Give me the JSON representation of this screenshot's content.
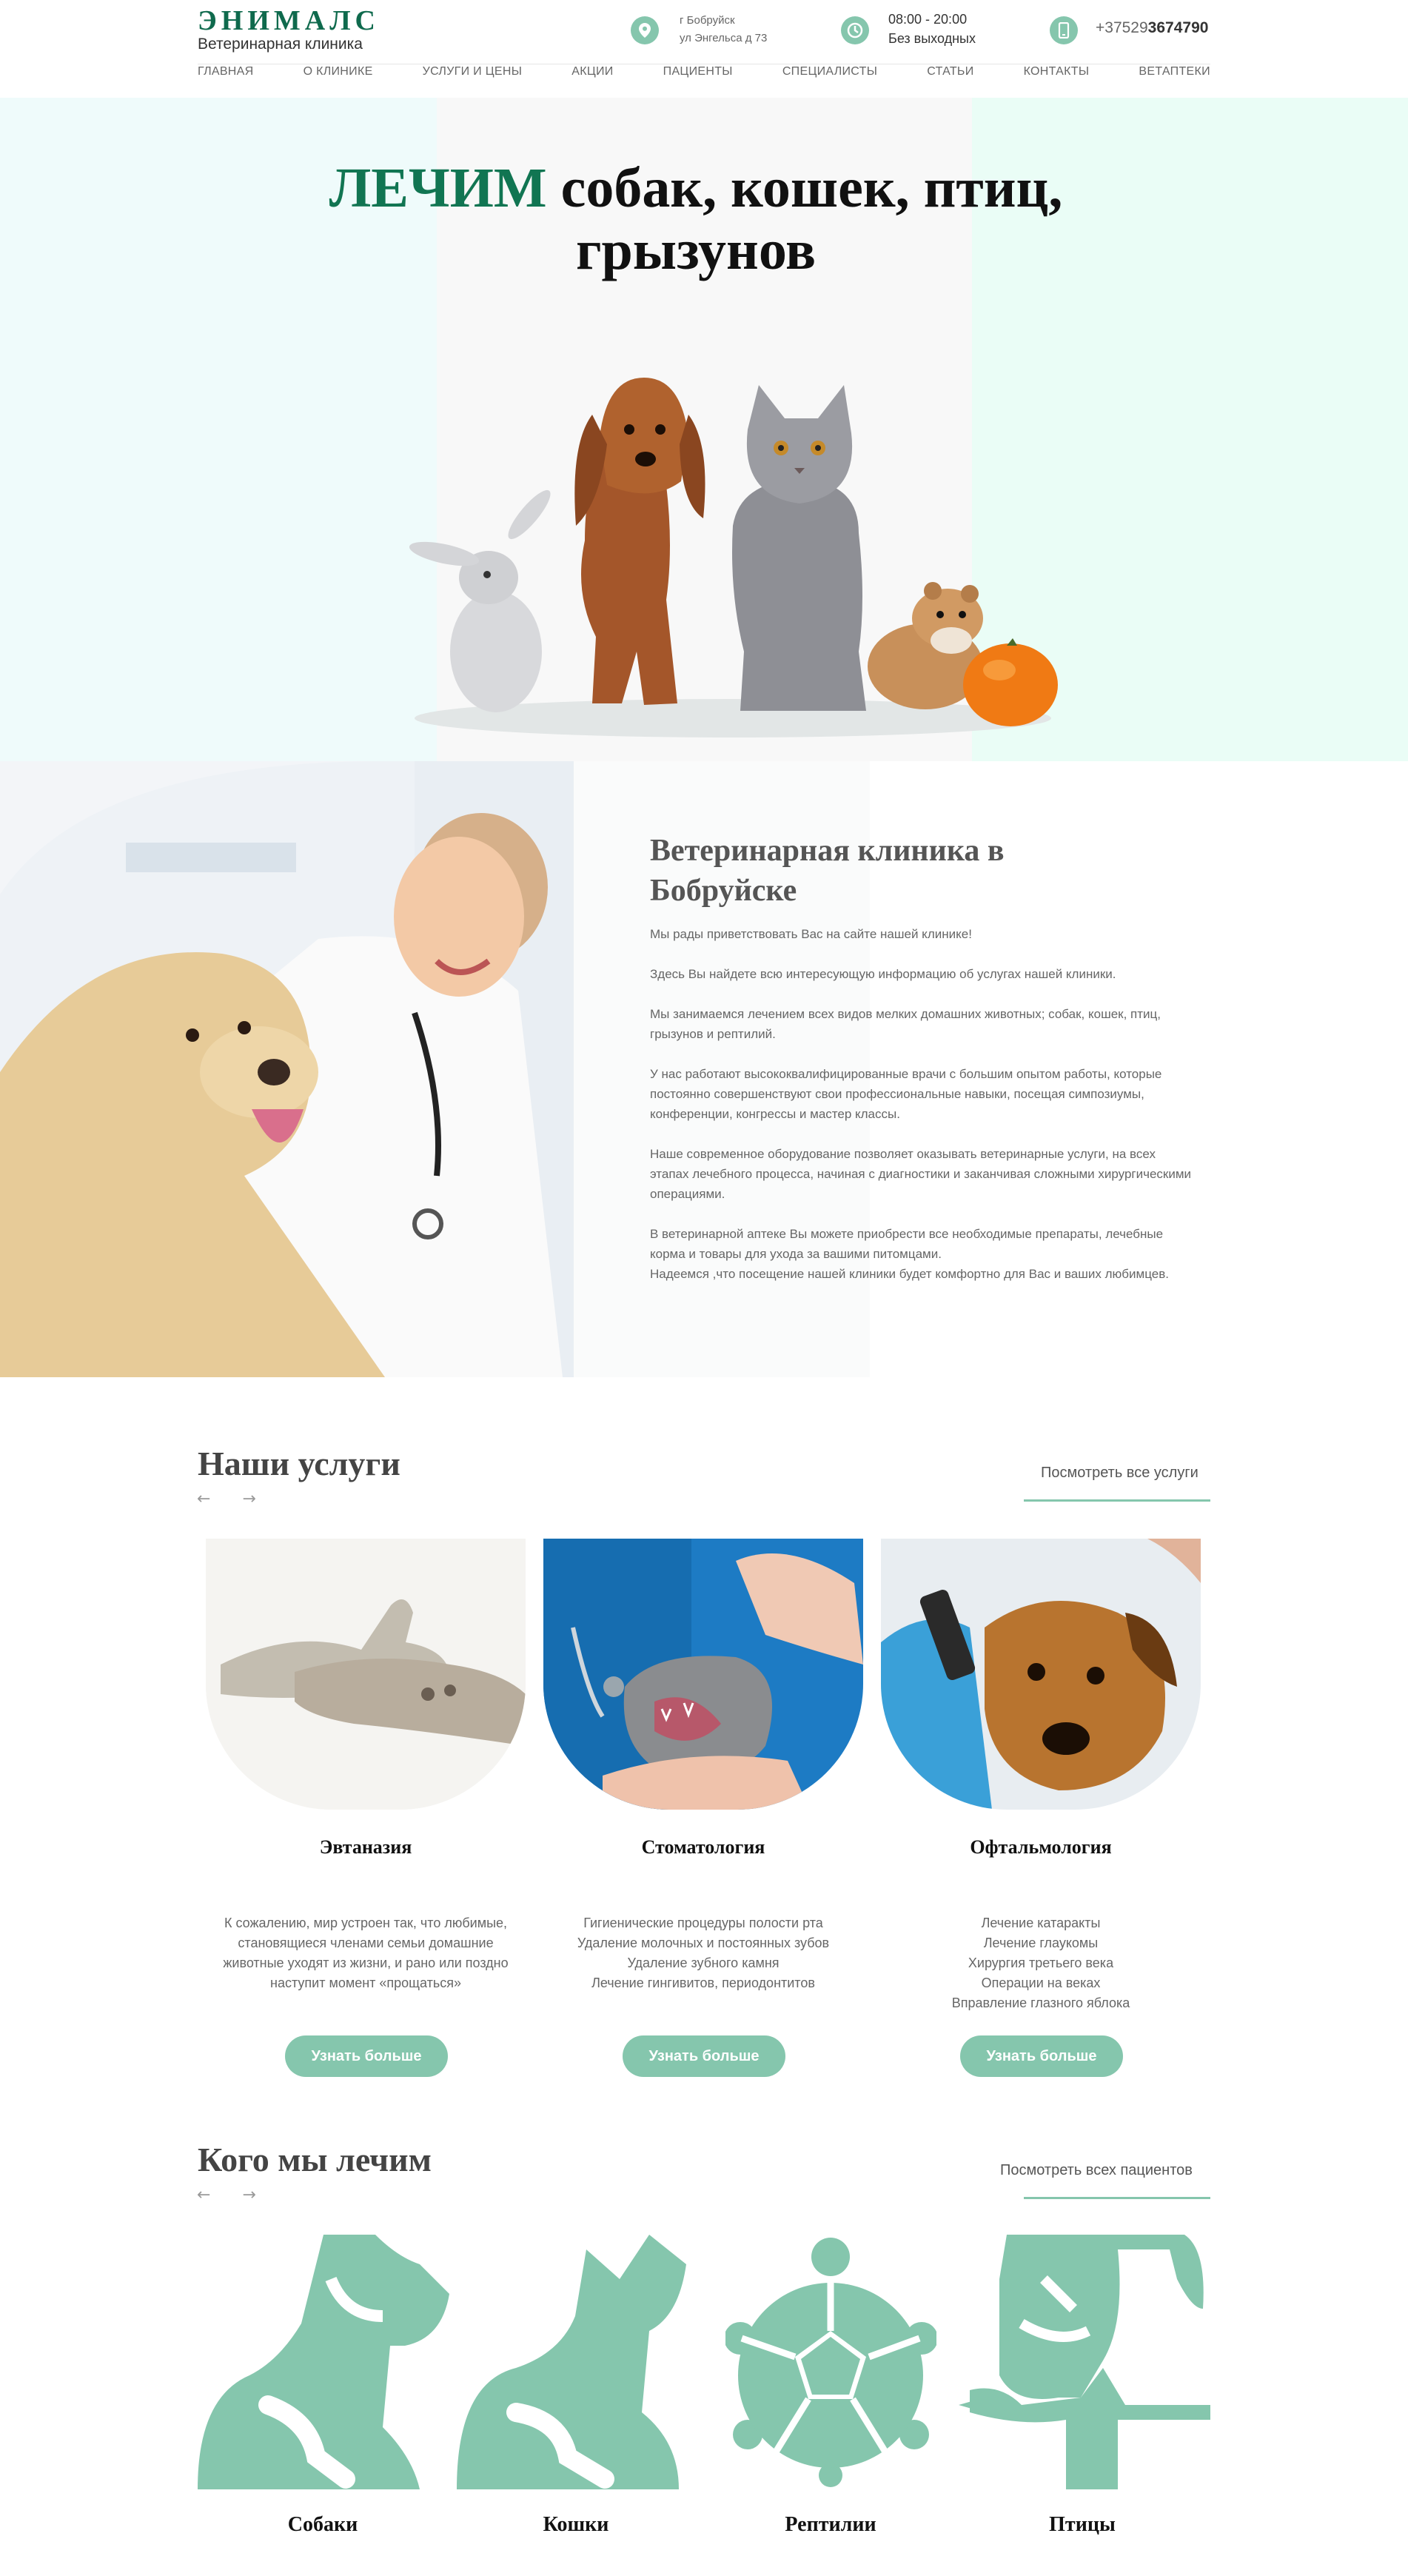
{
  "header": {
    "logo": "ЭНИМАЛС",
    "subtitle": "Ветеринарная клиника",
    "address_line1": "г Бобруйск",
    "address_line2": "ул Энгельса д 73",
    "hours_line1": "08:00 - 20:00",
    "hours_line2": "Без выходных",
    "phone_prefix": "+37529",
    "phone_number": "3674790",
    "accent_color": "#85c6ad",
    "icons": [
      "location-pin-icon",
      "clock-icon",
      "phone-icon"
    ]
  },
  "nav": [
    "ГЛАВНАЯ",
    "О КЛИНИКЕ",
    "УСЛУГИ И ЦЕНЫ",
    "АКЦИИ",
    "ПАЦИЕНТЫ",
    "СПЕЦИАЛИСТЫ",
    "СТАТЬИ",
    "КОНТАКТЫ",
    "ВЕТАПТЕКИ"
  ],
  "hero": {
    "title_accent": "ЛЕЧИМ",
    "title_rest": " собак, кошек, птиц,",
    "title_line2": "грызунов",
    "accent_color": "#117552"
  },
  "about": {
    "title": "Ветеринарная клиника в Бобруйске",
    "p1": "Мы рады приветствовать Вас на сайте нашей клинике!",
    "p2": "Здесь Вы найдете всю интересующую информацию об услугах нашей клиники.",
    "p3": "Мы занимаемся лечением всех видов мелких домашних животных; собак, кошек, птиц, грызунов и рептилий.",
    "p4": "У нас работают высококвалифицированные врачи с большим опытом работы, которые постоянно совершенствуют свои профессиональные навыки, посещая симпозиумы, конференции, конгрессы и мастер классы.",
    "p5": "Наше современное оборудование позволяет оказывать ветеринарные услуги, на всех этапах лечебного процесса, начиная с диагностики и заканчивая сложными хирургическими операциями.",
    "p6": "В ветеринарной аптеке Вы можете приобрести все необходимые препараты, лечебные корма и товары для ухода за вашими питомцами.",
    "p7": "Надеемся ,что посещение нашей клиники будет комфортно для Вас и ваших любимцев."
  },
  "services": {
    "title": "Наши услуги",
    "arrows": "← →",
    "see_all": "Посмотреть все услуги",
    "cards": [
      {
        "title": "Эвтаназия",
        "lines": [
          "К сожалению, мир устроен так, что любимые,",
          "становящиеся членами семьи домашние",
          "животные уходят из жизни, и рано или поздно",
          "наступит момент «прощаться»"
        ],
        "button": "Узнать больше"
      },
      {
        "title": "Стоматология",
        "lines": [
          "Гигиенические процедуры полости рта",
          "Удаление молочных и постоянных зубов",
          "Удаление зубного камня",
          "Лечение гингивитов, периодонтитов"
        ],
        "button": "Узнать больше"
      },
      {
        "title": "Офтальмология",
        "lines": [
          "Лечение катаракты",
          "Лечение глаукомы",
          "Хирургия третьего века",
          "Операции на веках",
          "Вправление глазного яблока"
        ],
        "button": "Узнать больше"
      }
    ]
  },
  "patients": {
    "title": "Кого мы лечим",
    "arrows": "← →",
    "see_all": "Посмотреть всех пациентов",
    "items": [
      {
        "label": "Собаки",
        "icon": "dog-icon"
      },
      {
        "label": "Кошки",
        "icon": "cat-icon"
      },
      {
        "label": "Рептилии",
        "icon": "turtle-icon"
      },
      {
        "label": "Птицы",
        "icon": "parrot-icon"
      }
    ]
  }
}
